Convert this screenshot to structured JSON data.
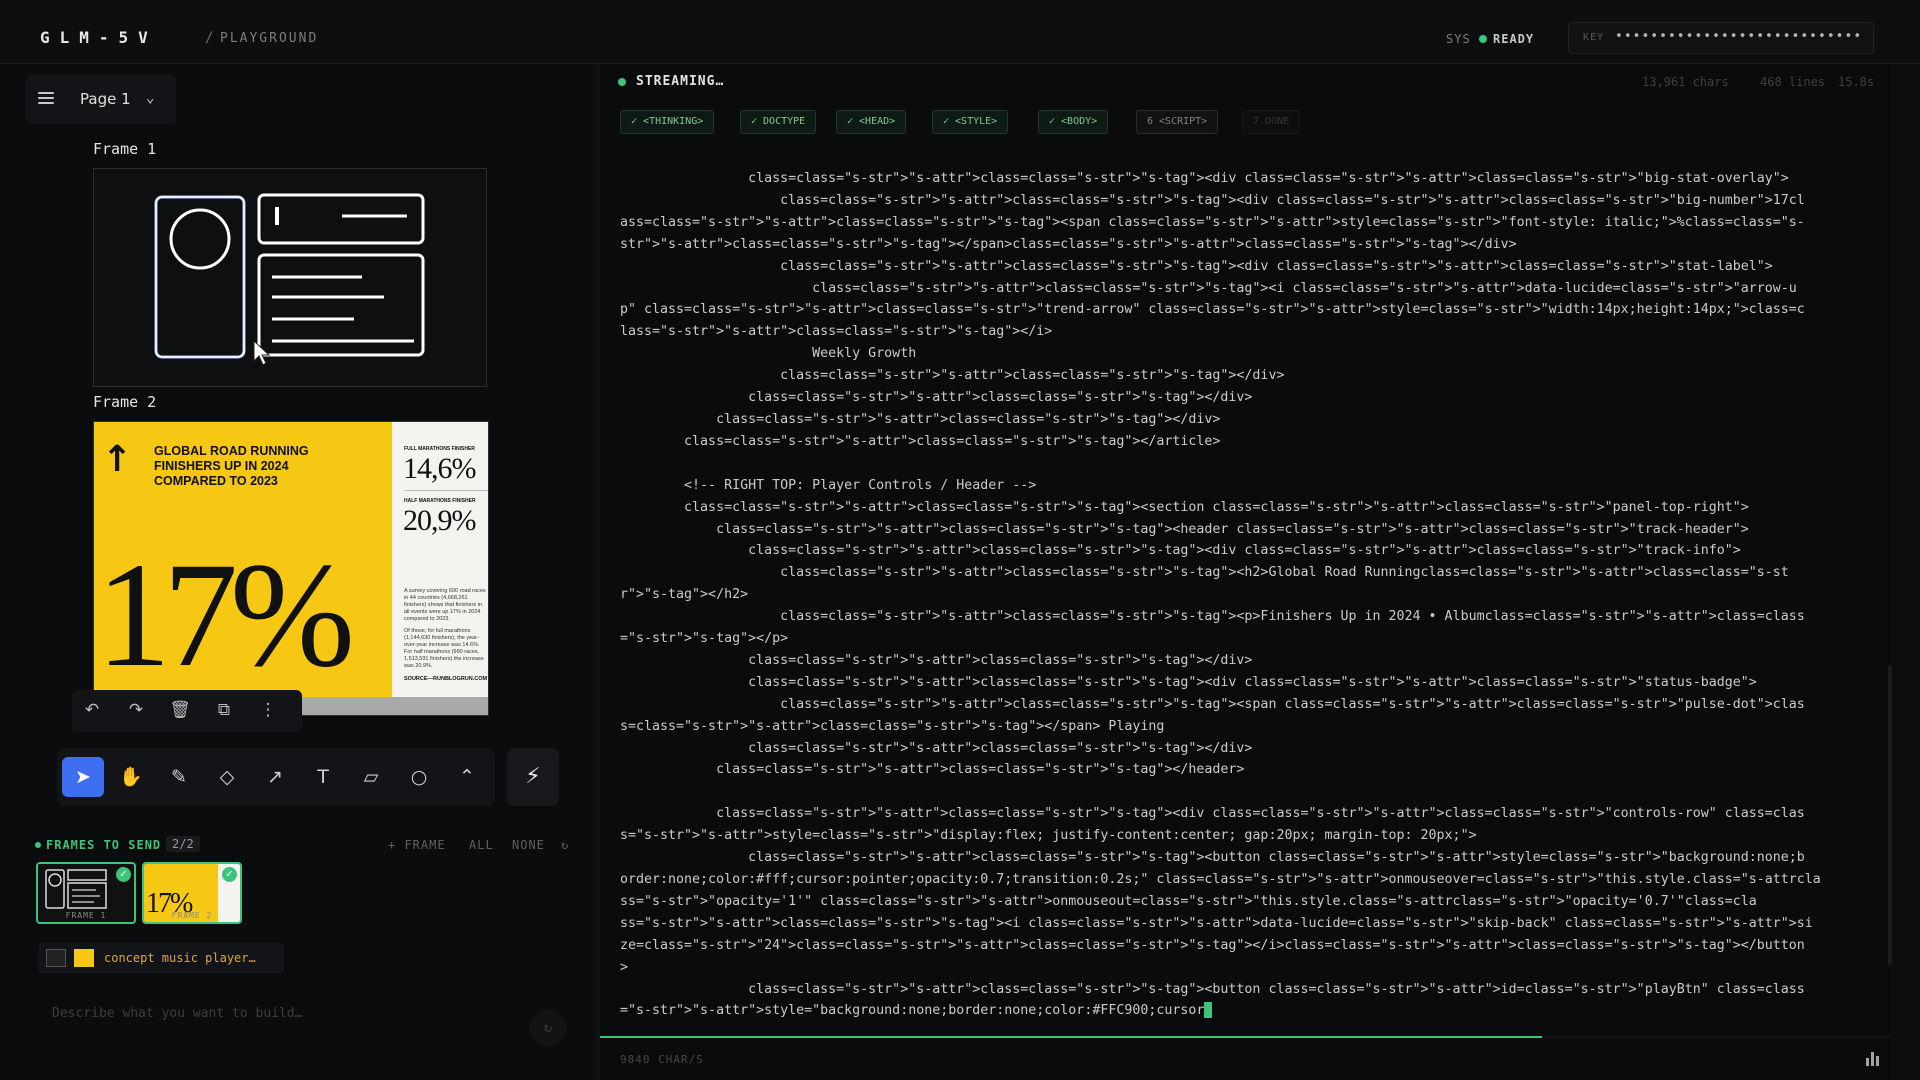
{
  "topbar": {
    "brand": "GLM-5V",
    "separator": "/",
    "section": "PLAYGROUND",
    "sys_label": "SYS",
    "status": "READY",
    "key_label": "KEY",
    "key_value": "••••••••••••••••••••••••••••"
  },
  "canvas": {
    "page_label": "Page 1",
    "frames": [
      {
        "title": "Frame 1"
      },
      {
        "title": "Frame 2"
      }
    ],
    "poster": {
      "headline": "GLOBAL ROAD RUNNING FINISHERS UP IN 2024 COMPARED TO 2023",
      "big_number": "17%",
      "stat1_label": "FULL MARATHONS FINISHER",
      "stat1_value": "14,6%",
      "stat2_label": "HALF MARATHONS FINISHER",
      "stat2_value": "20,9%",
      "body1": "A survey covering 600 road races in 44 countries (4,668,261 finishers) shows that finishers in all events were up 17% in 2024 compared to 2023.",
      "body2": "Of those, for full marathons (1,144,630 finishers), the year-over-year increase was 14.6%. For half marathons (990 races, 1,513,531 finishers) the increase was 20.9%.",
      "source": "SOURCE—RUNBLOGRUN.COM"
    }
  },
  "tools": {
    "items": [
      "select",
      "hand",
      "pencil",
      "eraser",
      "arrow",
      "text",
      "note",
      "ellipse",
      "more"
    ],
    "active": "select"
  },
  "frames_to_send": {
    "label": "FRAMES TO SEND",
    "count": "2/2",
    "add_frame": "+ FRAME",
    "all": "ALL",
    "none": "NONE",
    "thumbs": [
      {
        "label": "FRAME 1"
      },
      {
        "label": "FRAME 2"
      }
    ]
  },
  "chip": {
    "text": "concept music player…"
  },
  "prompt": {
    "placeholder": "Describe what you want to build…"
  },
  "stream": {
    "status": "STREAMING…",
    "chars": "13,961 chars",
    "lines": "468 lines",
    "time": "15.8s",
    "tags": [
      {
        "label": "✓ <THINKING>",
        "state": "done"
      },
      {
        "label": "✓ DOCTYPE",
        "state": "done"
      },
      {
        "label": "✓ <HEAD>",
        "state": "done"
      },
      {
        "label": "✓ <STYLE>",
        "state": "done"
      },
      {
        "label": "✓ <BODY>",
        "state": "done"
      },
      {
        "label": "6 <SCRIPT>",
        "state": "pending"
      },
      {
        "label": "7 DONE",
        "state": "future"
      }
    ],
    "code_lines": [
      "                class=class=\"s-str\">\"s-attr\">class=class=\"s-str\">\"s-tag\"><div class=class=\"s-str\">\"s-attr\">class=class=\"s-str\">\"big-stat-overlay\">",
      "                    class=class=\"s-str\">\"s-attr\">class=class=\"s-str\">\"s-tag\"><div class=class=\"s-str\">\"s-attr\">class=class=\"s-str\">\"big-number\">17cl",
      "ass=class=\"s-str\">\"s-attr\">class=class=\"s-str\">\"s-tag\"><span class=class=\"s-str\">\"s-attr\">style=class=\"s-str\">\"font-style: italic;\">%class=class=\"s-",
      "str\">\"s-attr\">class=class=\"s-str\">\"s-tag\"></span>class=class=\"s-str\">\"s-attr\">class=class=\"s-str\">\"s-tag\"></div>",
      "                    class=class=\"s-str\">\"s-attr\">class=class=\"s-str\">\"s-tag\"><div class=class=\"s-str\">\"s-attr\">class=class=\"s-str\">\"stat-label\">",
      "                        class=class=\"s-str\">\"s-attr\">class=class=\"s-str\">\"s-tag\"><i class=class=\"s-str\">\"s-attr\">data-lucide=class=\"s-str\">\"arrow-u",
      "p\" class=class=\"s-str\">\"s-attr\">class=class=\"s-str\">\"trend-arrow\" class=class=\"s-str\">\"s-attr\">style=class=\"s-str\">\"width:14px;height:14px;\">class=c",
      "lass=\"s-str\">\"s-attr\">class=class=\"s-str\">\"s-tag\"></i>",
      "                        Weekly Growth",
      "                    class=class=\"s-str\">\"s-attr\">class=class=\"s-str\">\"s-tag\"></div>",
      "                class=class=\"s-str\">\"s-attr\">class=class=\"s-str\">\"s-tag\"></div>",
      "            class=class=\"s-str\">\"s-attr\">class=class=\"s-str\">\"s-tag\"></div>",
      "        class=class=\"s-str\">\"s-attr\">class=class=\"s-str\">\"s-tag\"></article>",
      "",
      "        <!-- RIGHT TOP: Player Controls / Header -->",
      "        class=class=\"s-str\">\"s-attr\">class=class=\"s-str\">\"s-tag\"><section class=class=\"s-str\">\"s-attr\">class=class=\"s-str\">\"panel-top-right\">",
      "            class=class=\"s-str\">\"s-attr\">class=class=\"s-str\">\"s-tag\"><header class=class=\"s-str\">\"s-attr\">class=class=\"s-str\">\"track-header\">",
      "                class=class=\"s-str\">\"s-attr\">class=class=\"s-str\">\"s-tag\"><div class=class=\"s-str\">\"s-attr\">class=class=\"s-str\">\"track-info\">",
      "                    class=class=\"s-str\">\"s-attr\">class=class=\"s-str\">\"s-tag\"><h2>Global Road Runningclass=class=\"s-str\">\"s-attr\">class=class=\"s-st",
      "r\">\"s-tag\"></h2>",
      "                    class=class=\"s-str\">\"s-attr\">class=class=\"s-str\">\"s-tag\"><p>Finishers Up in 2024 • Albumclass=class=\"s-str\">\"s-attr\">class=class",
      "=\"s-str\">\"s-tag\"></p>",
      "                class=class=\"s-str\">\"s-attr\">class=class=\"s-str\">\"s-tag\"></div>",
      "                class=class=\"s-str\">\"s-attr\">class=class=\"s-str\">\"s-tag\"><div class=class=\"s-str\">\"s-attr\">class=class=\"s-str\">\"status-badge\">",
      "                    class=class=\"s-str\">\"s-attr\">class=class=\"s-str\">\"s-tag\"><span class=class=\"s-str\">\"s-attr\">class=class=\"s-str\">\"pulse-dot\">clas",
      "s=class=\"s-str\">\"s-attr\">class=class=\"s-str\">\"s-tag\"></span> Playing",
      "                class=class=\"s-str\">\"s-attr\">class=class=\"s-str\">\"s-tag\"></div>",
      "            class=class=\"s-str\">\"s-attr\">class=class=\"s-str\">\"s-tag\"></header>",
      "",
      "            class=class=\"s-str\">\"s-attr\">class=class=\"s-str\">\"s-tag\"><div class=class=\"s-str\">\"s-attr\">class=class=\"s-str\">\"controls-row\" class=clas",
      "s=\"s-str\">\"s-attr\">style=class=\"s-str\">\"display:flex; justify-content:center; gap:20px; margin-top: 20px;\">",
      "                class=class=\"s-str\">\"s-attr\">class=class=\"s-str\">\"s-tag\"><button class=class=\"s-str\">\"s-attr\">style=class=\"s-str\">\"background:none;b",
      "order:none;color:#fff;cursor:pointer;opacity:0.7;transition:0.2s;\" class=class=\"s-str\">\"s-attr\">onmouseover=class=\"s-str\">\"this.style.class=\"s-attrcla",
      "ss=\"s-str\">\"opacity='1'\" class=class=\"s-str\">\"s-attr\">onmouseout=class=\"s-str\">\"this.style.class=\"s-attrclass=\"s-str\">\"opacity='0.7'\"class=cla",
      "ss=\"s-str\">\"s-attr\">class=class=\"s-str\">\"s-tag\"><i class=class=\"s-str\">\"s-attr\">data-lucide=class=\"s-str\">\"skip-back\" class=class=\"s-str\">\"s-attr\">si",
      "ze=class=\"s-str\">\"24\">class=class=\"s-str\">\"s-attr\">class=class=\"s-str\">\"s-tag\"></i>class=class=\"s-str\">\"s-attr\">class=class=\"s-str\">\"s-tag\"></button",
      ">",
      "                class=class=\"s-str\">\"s-attr\">class=class=\"s-str\">\"s-tag\"><button class=class=\"s-str\">\"s-attr\">id=class=\"s-str\">\"playBtn\" class=class",
      "=\"s-str\">\"s-attr\">style=\"background:none;border:none;color:#FFC900;cursor"
    ],
    "progress": 0.73,
    "rate": "9840 CHAR/S"
  },
  "colors": {
    "accent_green": "#3cc47a",
    "active_tool": "#3d6ff0",
    "poster_yellow": "#f6c814"
  }
}
